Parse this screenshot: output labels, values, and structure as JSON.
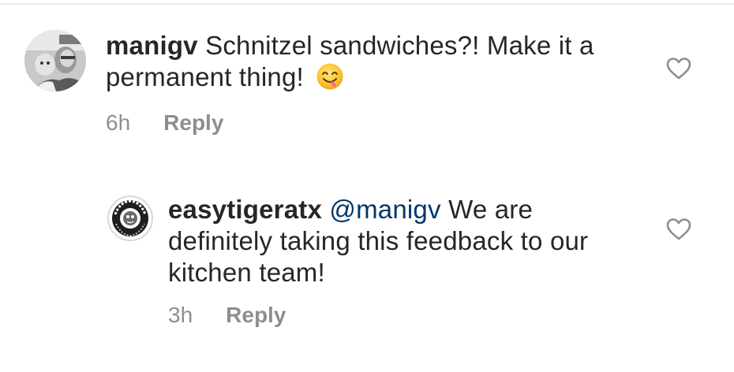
{
  "comments": [
    {
      "username": "manigv",
      "text": "Schnitzel sandwiches?! Make it a permanent thing!",
      "emoji": "yum-face-emoji",
      "time": "6h",
      "reply_label": "Reply",
      "like_icon": "heart-outline-icon"
    },
    {
      "username": "easytigeratx",
      "mention": "@manigv",
      "text": "We are definitely taking this feedback to our kitchen team!",
      "time": "3h",
      "reply_label": "Reply",
      "like_icon": "heart-outline-icon",
      "avatar_logo": {
        "top_text": "EASY TIGER",
        "bottom_text": "BAKE SHOP & BEER GARDEN"
      }
    }
  ],
  "colors": {
    "text": "#262626",
    "muted": "#8e8e8e",
    "mention": "#00376b",
    "icon": "#8e8e8e"
  }
}
